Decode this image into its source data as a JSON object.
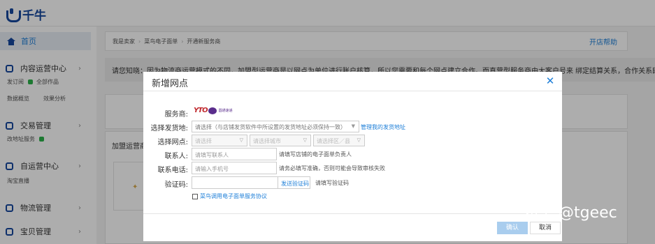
{
  "app": {
    "title": "千牛"
  },
  "sidebar": {
    "home": "首页",
    "groups": [
      {
        "label": "内容运营中心",
        "subs": [
          "发订阅",
          "全部作品",
          "数据概览",
          "效果分析"
        ]
      },
      {
        "label": "交易管理",
        "subs": [
          "改地址服务"
        ]
      },
      {
        "label": "自运营中心",
        "subs": [
          "淘宝直播"
        ]
      },
      {
        "label": "物流管理",
        "subs": []
      },
      {
        "label": "宝贝管理",
        "subs": []
      }
    ]
  },
  "breadcrumb": {
    "items": [
      "我是卖家",
      "菜鸟电子面单",
      "开通新服务商"
    ],
    "help": "开店帮助"
  },
  "notice": "请您知晓：因为物流商运营模式的不同，加盟型运营商是以网点为单位进行账户核算，所以您需要和每个网点建立合作。而直营型服务商由大客户号来 绑定结算关系，合作关系即",
  "main": {
    "panel_title": "加盟运营商"
  },
  "modal": {
    "title": "新增网点",
    "labels": {
      "carrier": "服务商:",
      "ship_from": "选择发货地:",
      "outlet": "选择网点:",
      "contact": "联系人:",
      "phone": "联系电话:",
      "code": "验证码:"
    },
    "carrier": {
      "logo": "YTO",
      "cn": "圆通速递"
    },
    "ship_from": {
      "placeholder": "请选择（与店铺发货软件中所设置的发货地址必须保持一致）",
      "manage_link": "管理我的发货地址"
    },
    "outlet": {
      "province": "请选择",
      "city": "请选择城市",
      "district": "请选择区／县"
    },
    "contact": {
      "placeholder": "请填写联系人",
      "hint": "请填写店铺的电子面单负责人"
    },
    "phone": {
      "placeholder": "请输入手机号",
      "hint": "请务必填写准确，否则可能会导致审核失败"
    },
    "code": {
      "value": "",
      "send": "发送验证码",
      "hint": "请填写验证码"
    },
    "agreement": "菜鸟调用电子面单服务协议",
    "confirm": "确认",
    "cancel": "取消"
  },
  "watermark": "知乎 @tgeec"
}
